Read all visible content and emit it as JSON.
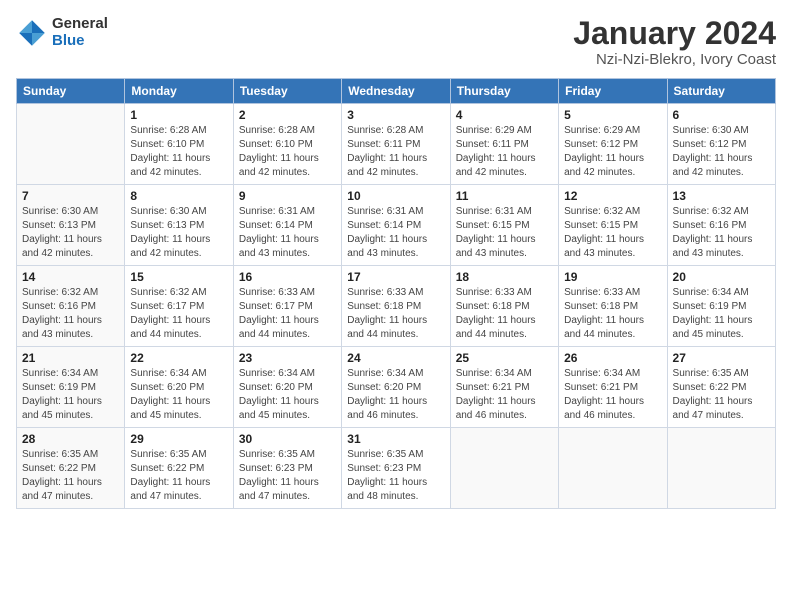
{
  "header": {
    "logo_general": "General",
    "logo_blue": "Blue",
    "title": "January 2024",
    "subtitle": "Nzi-Nzi-Blekro, Ivory Coast"
  },
  "days_of_week": [
    "Sunday",
    "Monday",
    "Tuesday",
    "Wednesday",
    "Thursday",
    "Friday",
    "Saturday"
  ],
  "weeks": [
    [
      {
        "day": "",
        "sunrise": "",
        "sunset": "",
        "daylight": ""
      },
      {
        "day": "1",
        "sunrise": "Sunrise: 6:28 AM",
        "sunset": "Sunset: 6:10 PM",
        "daylight": "Daylight: 11 hours and 42 minutes."
      },
      {
        "day": "2",
        "sunrise": "Sunrise: 6:28 AM",
        "sunset": "Sunset: 6:10 PM",
        "daylight": "Daylight: 11 hours and 42 minutes."
      },
      {
        "day": "3",
        "sunrise": "Sunrise: 6:28 AM",
        "sunset": "Sunset: 6:11 PM",
        "daylight": "Daylight: 11 hours and 42 minutes."
      },
      {
        "day": "4",
        "sunrise": "Sunrise: 6:29 AM",
        "sunset": "Sunset: 6:11 PM",
        "daylight": "Daylight: 11 hours and 42 minutes."
      },
      {
        "day": "5",
        "sunrise": "Sunrise: 6:29 AM",
        "sunset": "Sunset: 6:12 PM",
        "daylight": "Daylight: 11 hours and 42 minutes."
      },
      {
        "day": "6",
        "sunrise": "Sunrise: 6:30 AM",
        "sunset": "Sunset: 6:12 PM",
        "daylight": "Daylight: 11 hours and 42 minutes."
      }
    ],
    [
      {
        "day": "7",
        "sunrise": "Sunrise: 6:30 AM",
        "sunset": "Sunset: 6:13 PM",
        "daylight": "Daylight: 11 hours and 42 minutes."
      },
      {
        "day": "8",
        "sunrise": "Sunrise: 6:30 AM",
        "sunset": "Sunset: 6:13 PM",
        "daylight": "Daylight: 11 hours and 42 minutes."
      },
      {
        "day": "9",
        "sunrise": "Sunrise: 6:31 AM",
        "sunset": "Sunset: 6:14 PM",
        "daylight": "Daylight: 11 hours and 43 minutes."
      },
      {
        "day": "10",
        "sunrise": "Sunrise: 6:31 AM",
        "sunset": "Sunset: 6:14 PM",
        "daylight": "Daylight: 11 hours and 43 minutes."
      },
      {
        "day": "11",
        "sunrise": "Sunrise: 6:31 AM",
        "sunset": "Sunset: 6:15 PM",
        "daylight": "Daylight: 11 hours and 43 minutes."
      },
      {
        "day": "12",
        "sunrise": "Sunrise: 6:32 AM",
        "sunset": "Sunset: 6:15 PM",
        "daylight": "Daylight: 11 hours and 43 minutes."
      },
      {
        "day": "13",
        "sunrise": "Sunrise: 6:32 AM",
        "sunset": "Sunset: 6:16 PM",
        "daylight": "Daylight: 11 hours and 43 minutes."
      }
    ],
    [
      {
        "day": "14",
        "sunrise": "Sunrise: 6:32 AM",
        "sunset": "Sunset: 6:16 PM",
        "daylight": "Daylight: 11 hours and 43 minutes."
      },
      {
        "day": "15",
        "sunrise": "Sunrise: 6:32 AM",
        "sunset": "Sunset: 6:17 PM",
        "daylight": "Daylight: 11 hours and 44 minutes."
      },
      {
        "day": "16",
        "sunrise": "Sunrise: 6:33 AM",
        "sunset": "Sunset: 6:17 PM",
        "daylight": "Daylight: 11 hours and 44 minutes."
      },
      {
        "day": "17",
        "sunrise": "Sunrise: 6:33 AM",
        "sunset": "Sunset: 6:18 PM",
        "daylight": "Daylight: 11 hours and 44 minutes."
      },
      {
        "day": "18",
        "sunrise": "Sunrise: 6:33 AM",
        "sunset": "Sunset: 6:18 PM",
        "daylight": "Daylight: 11 hours and 44 minutes."
      },
      {
        "day": "19",
        "sunrise": "Sunrise: 6:33 AM",
        "sunset": "Sunset: 6:18 PM",
        "daylight": "Daylight: 11 hours and 44 minutes."
      },
      {
        "day": "20",
        "sunrise": "Sunrise: 6:34 AM",
        "sunset": "Sunset: 6:19 PM",
        "daylight": "Daylight: 11 hours and 45 minutes."
      }
    ],
    [
      {
        "day": "21",
        "sunrise": "Sunrise: 6:34 AM",
        "sunset": "Sunset: 6:19 PM",
        "daylight": "Daylight: 11 hours and 45 minutes."
      },
      {
        "day": "22",
        "sunrise": "Sunrise: 6:34 AM",
        "sunset": "Sunset: 6:20 PM",
        "daylight": "Daylight: 11 hours and 45 minutes."
      },
      {
        "day": "23",
        "sunrise": "Sunrise: 6:34 AM",
        "sunset": "Sunset: 6:20 PM",
        "daylight": "Daylight: 11 hours and 45 minutes."
      },
      {
        "day": "24",
        "sunrise": "Sunrise: 6:34 AM",
        "sunset": "Sunset: 6:20 PM",
        "daylight": "Daylight: 11 hours and 46 minutes."
      },
      {
        "day": "25",
        "sunrise": "Sunrise: 6:34 AM",
        "sunset": "Sunset: 6:21 PM",
        "daylight": "Daylight: 11 hours and 46 minutes."
      },
      {
        "day": "26",
        "sunrise": "Sunrise: 6:34 AM",
        "sunset": "Sunset: 6:21 PM",
        "daylight": "Daylight: 11 hours and 46 minutes."
      },
      {
        "day": "27",
        "sunrise": "Sunrise: 6:35 AM",
        "sunset": "Sunset: 6:22 PM",
        "daylight": "Daylight: 11 hours and 47 minutes."
      }
    ],
    [
      {
        "day": "28",
        "sunrise": "Sunrise: 6:35 AM",
        "sunset": "Sunset: 6:22 PM",
        "daylight": "Daylight: 11 hours and 47 minutes."
      },
      {
        "day": "29",
        "sunrise": "Sunrise: 6:35 AM",
        "sunset": "Sunset: 6:22 PM",
        "daylight": "Daylight: 11 hours and 47 minutes."
      },
      {
        "day": "30",
        "sunrise": "Sunrise: 6:35 AM",
        "sunset": "Sunset: 6:23 PM",
        "daylight": "Daylight: 11 hours and 47 minutes."
      },
      {
        "day": "31",
        "sunrise": "Sunrise: 6:35 AM",
        "sunset": "Sunset: 6:23 PM",
        "daylight": "Daylight: 11 hours and 48 minutes."
      },
      {
        "day": "",
        "sunrise": "",
        "sunset": "",
        "daylight": ""
      },
      {
        "day": "",
        "sunrise": "",
        "sunset": "",
        "daylight": ""
      },
      {
        "day": "",
        "sunrise": "",
        "sunset": "",
        "daylight": ""
      }
    ]
  ]
}
